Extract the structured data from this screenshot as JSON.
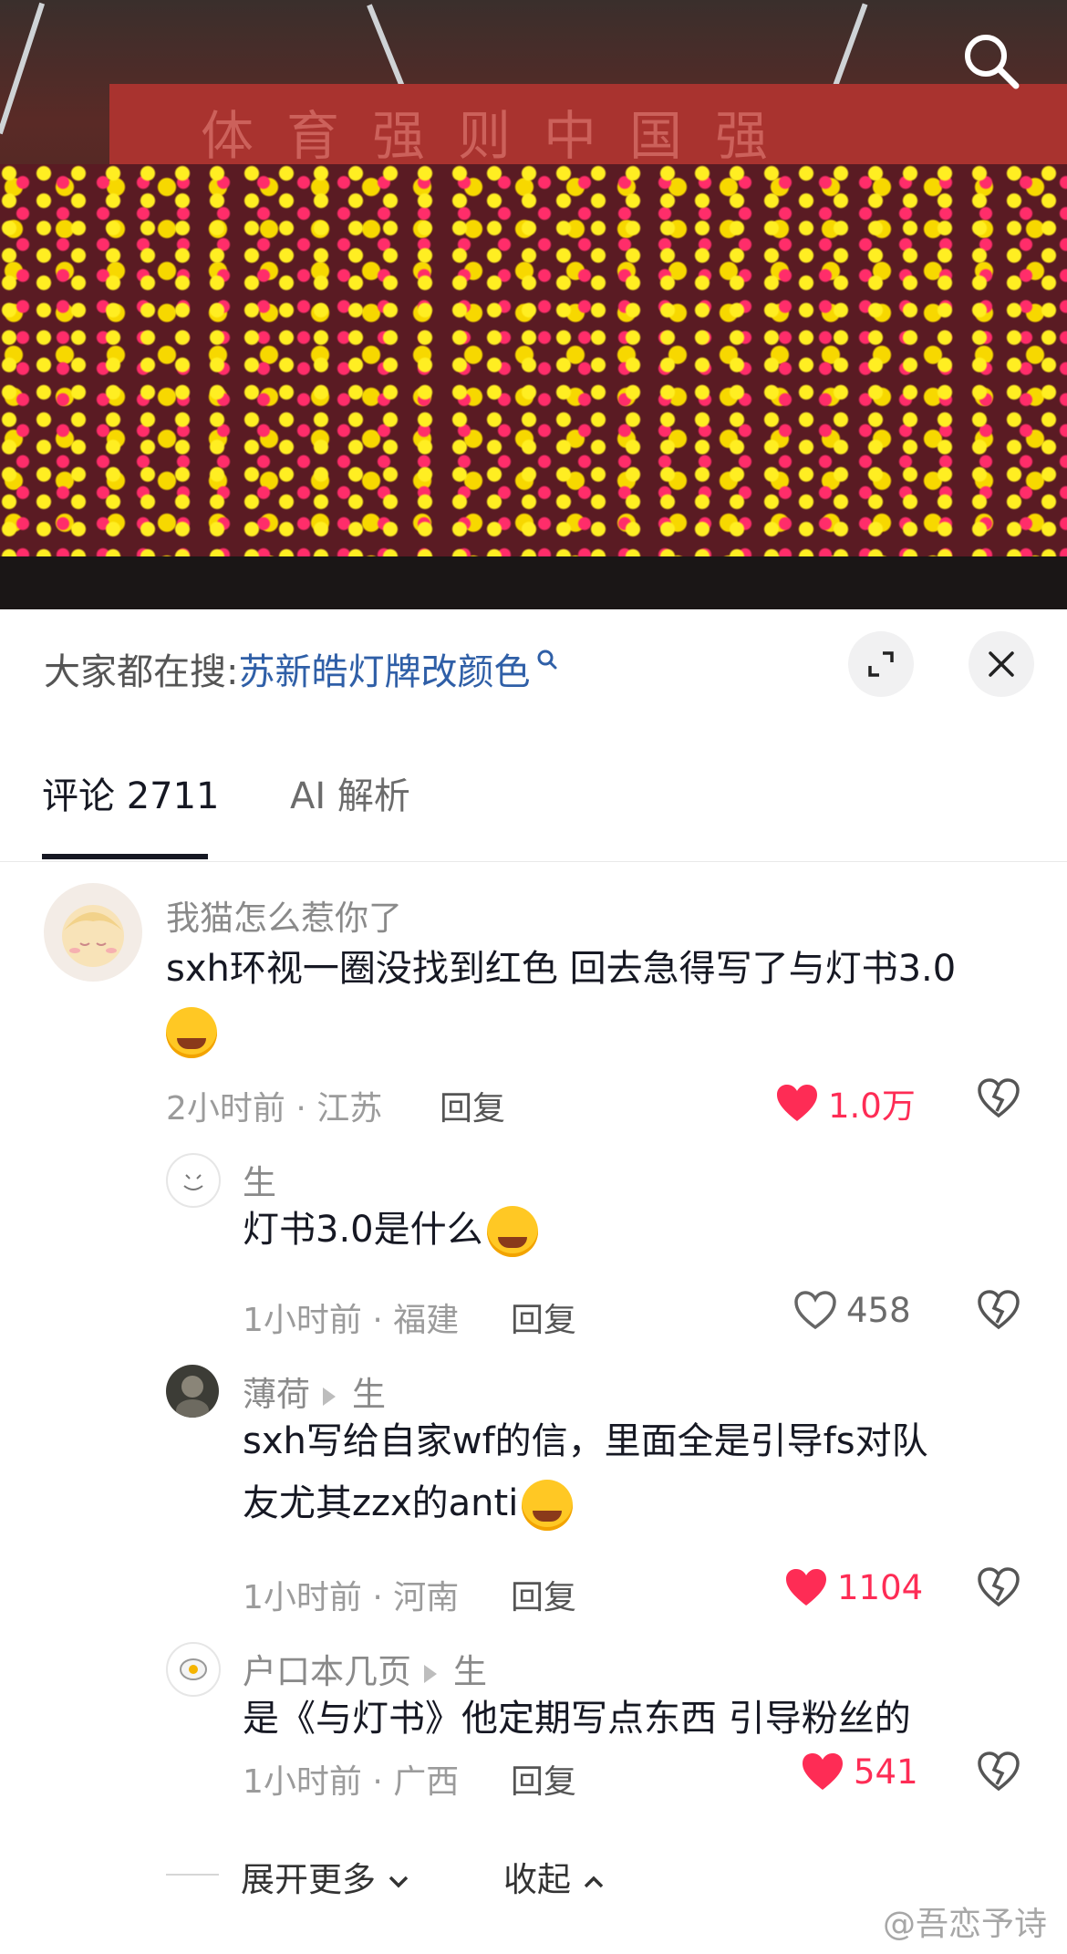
{
  "search_bar": {
    "prefix": "大家都在搜:",
    "query": "苏新皓灯牌改颜色"
  },
  "tabs": [
    {
      "label": "评论 2711",
      "active": true
    },
    {
      "label": "AI 解析",
      "active": false
    }
  ],
  "comments": [
    {
      "user": "我猫怎么惹你了",
      "text": "sxh环视一圈没找到红色 回去急得写了与灯书3.0",
      "time_location": "2小时前 · 江苏",
      "reply_label": "回复",
      "likes": "1.0万",
      "liked": true
    }
  ],
  "replies": [
    {
      "user": "生",
      "reply_to": "",
      "text": "灯书3.0是什么",
      "time_location": "1小时前 · 福建",
      "reply_label": "回复",
      "likes": "458",
      "liked": false
    },
    {
      "user": "薄荷",
      "reply_to": "生",
      "text_line1": "sxh写给自家wf的信，里面全是引导fs对队",
      "text_line2": "友尤其zzx的anti",
      "time_location": "1小时前 · 河南",
      "reply_label": "回复",
      "likes": "1104",
      "liked": true
    },
    {
      "user": "户口本几页",
      "reply_to": "生",
      "text": "是《与灯书》他定期写点东西 引导粉丝的",
      "time_location": "1小时前 · 广西",
      "reply_label": "回复",
      "likes": "541",
      "liked": true
    }
  ],
  "footer": {
    "expand_label": "展开更多",
    "collapse_label": "收起"
  },
  "video": {
    "banner_text": "体育强则中国强"
  },
  "watermark": "@吾恋予诗",
  "colors": {
    "like_red": "#fe2c55",
    "link_blue": "#2f5fa7",
    "secondary_text": "#8a8a8a"
  }
}
